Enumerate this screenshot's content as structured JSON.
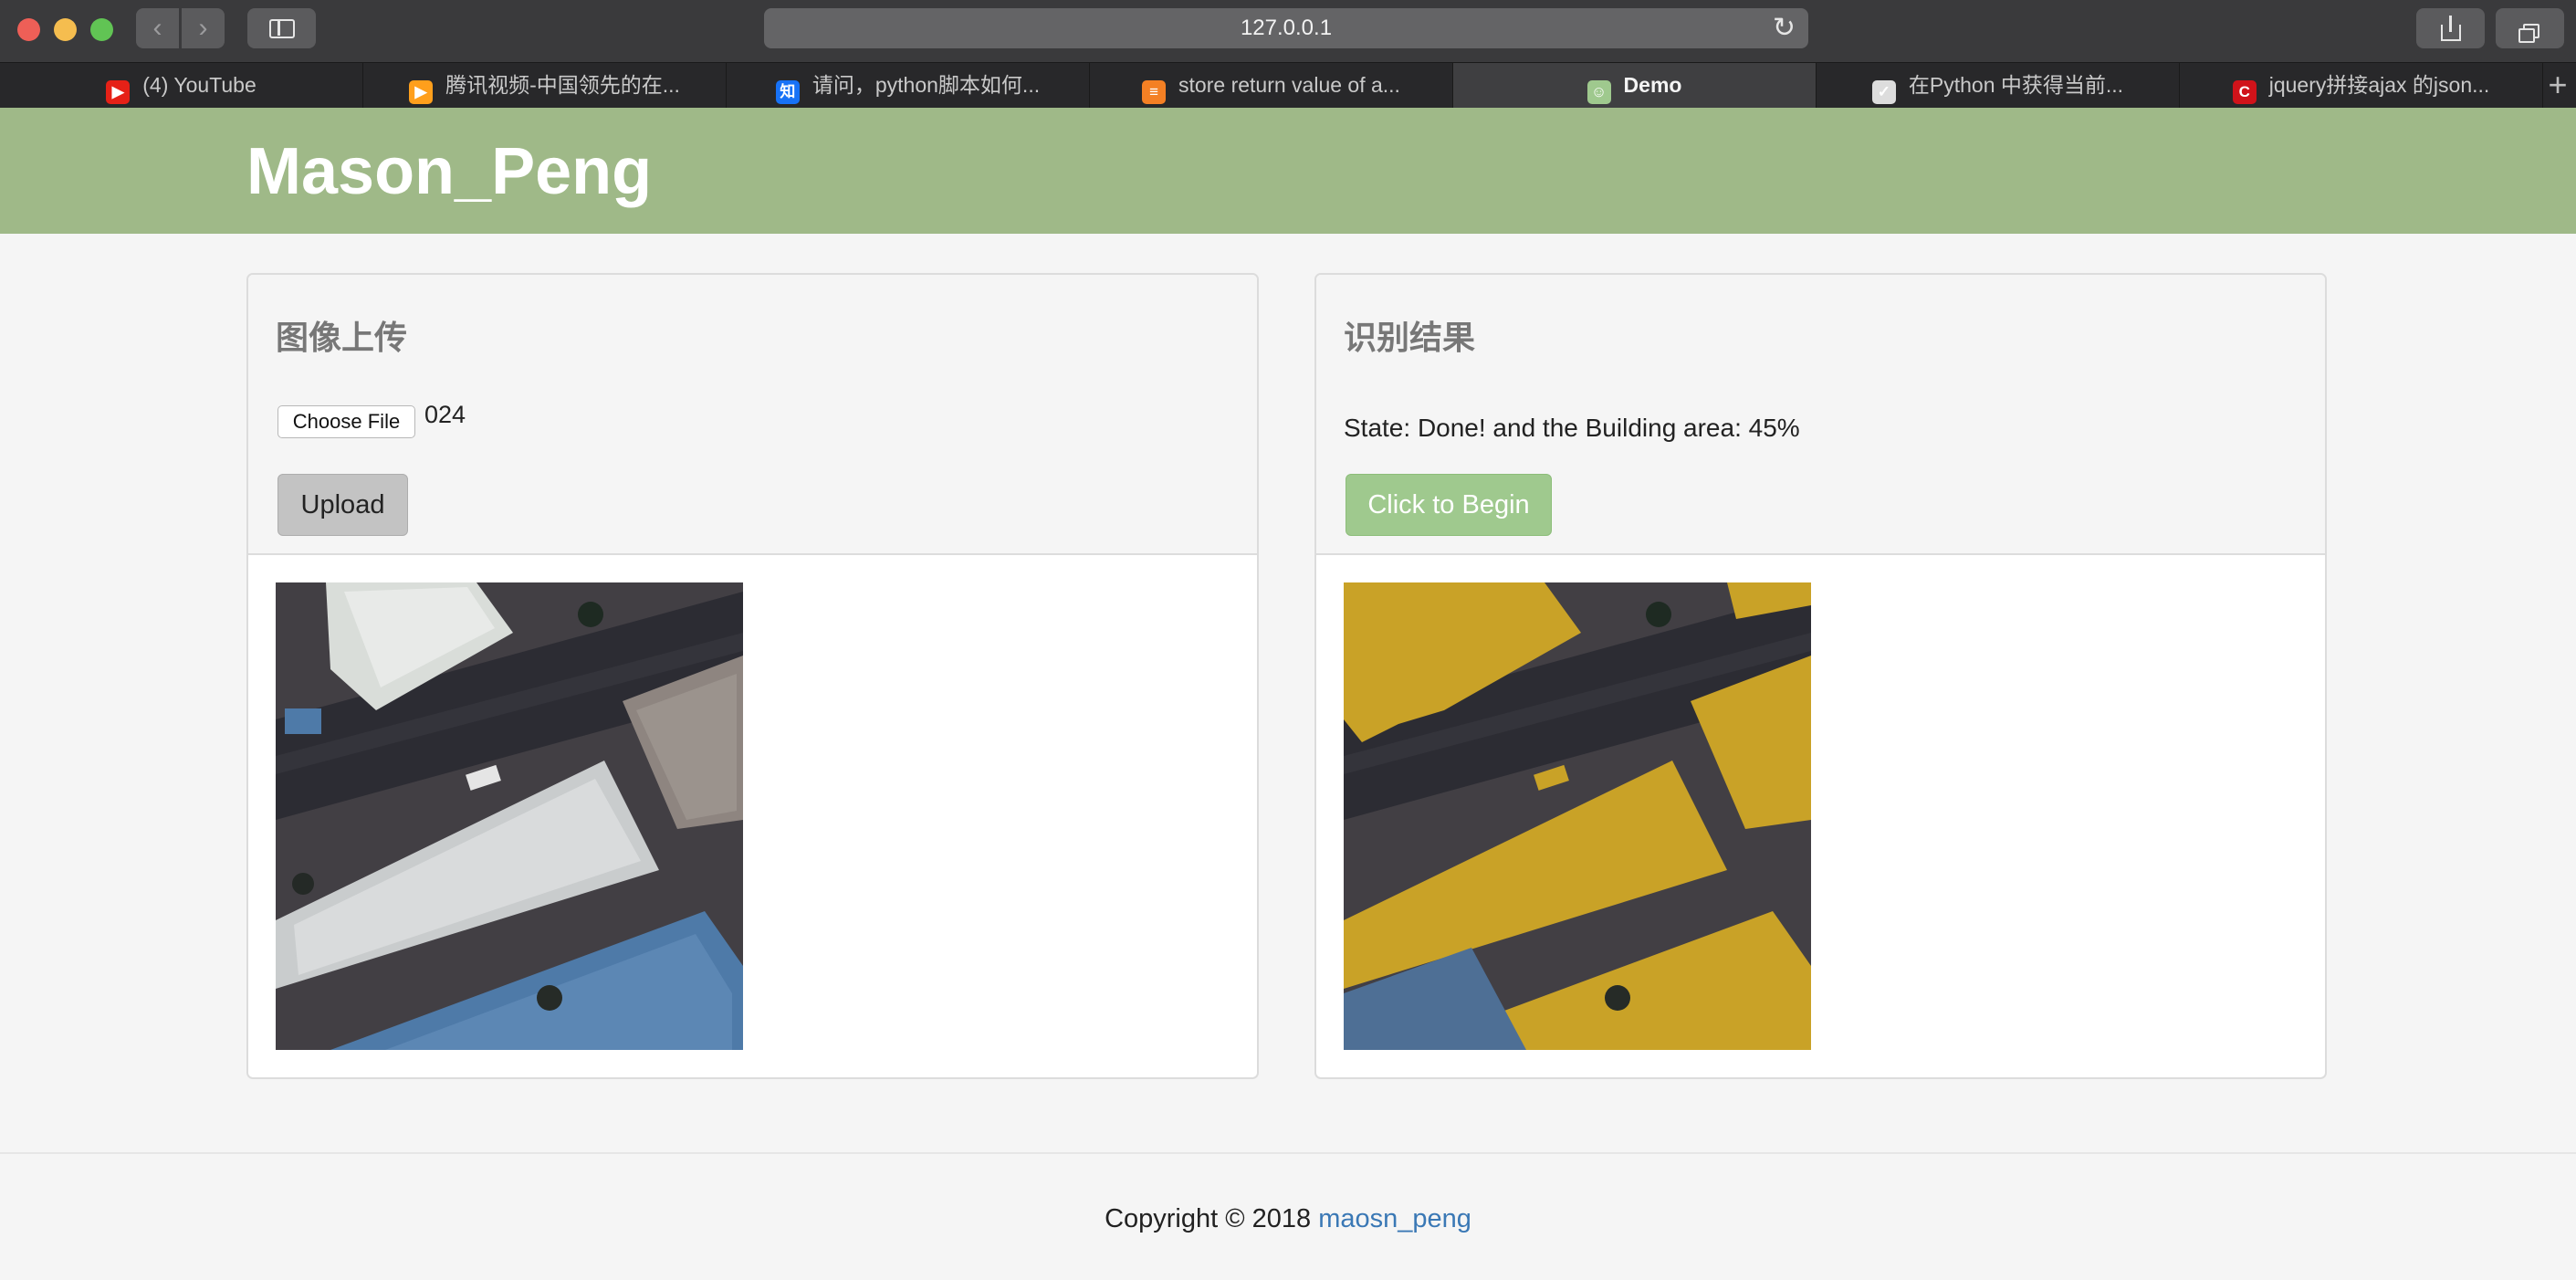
{
  "browser": {
    "url": "127.0.0.1",
    "tabs": [
      {
        "label": "(4) YouTube",
        "icon": "youtube-icon",
        "color": "#e62117",
        "glyph": "▶"
      },
      {
        "label": "腾讯视频-中国领先的在...",
        "icon": "tencent-video-icon",
        "color": "#ff9f1c",
        "glyph": "▶"
      },
      {
        "label": "请问，python脚本如何...",
        "icon": "zhihu-icon",
        "color": "#1772f6",
        "glyph": "知"
      },
      {
        "label": "store return value of a...",
        "icon": "stackoverflow-icon",
        "color": "#f48024",
        "glyph": "≡"
      },
      {
        "label": "Demo",
        "icon": "demo-icon",
        "color": "#9fc98e",
        "glyph": "☺"
      },
      {
        "label": "在Python 中获得当前...",
        "icon": "page-icon",
        "color": "#dddddd",
        "glyph": "✓"
      },
      {
        "label": "jquery拼接ajax 的json...",
        "icon": "csdn-icon",
        "color": "#d0131a",
        "glyph": "C"
      }
    ],
    "active_tab": 4
  },
  "header": {
    "brand": "Mason_Peng"
  },
  "upload_panel": {
    "title": "图像上传",
    "file_button": "Choose File",
    "file_name": "024",
    "upload_button": "Upload"
  },
  "result_panel": {
    "title": "识别结果",
    "state": "State: Done! and the Building area: 45%",
    "begin_button": "Click to Begin"
  },
  "footer": {
    "copyright": "Copyright © 2018",
    "author": "maosn_peng"
  },
  "colors": {
    "header_green": "#9fb988",
    "begin_green": "#9fc98e",
    "building_overlay": "#c9a227",
    "link_blue": "#3a78b5"
  }
}
